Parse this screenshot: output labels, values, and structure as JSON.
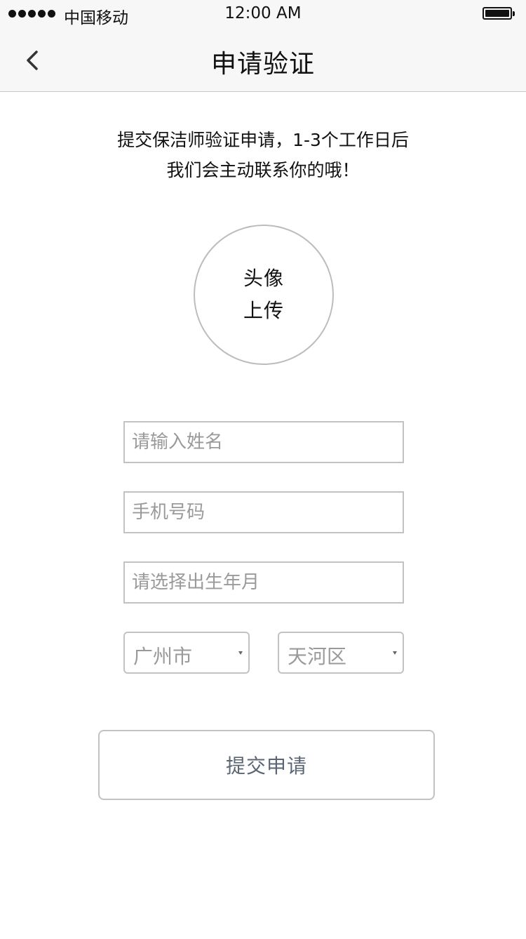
{
  "status_bar": {
    "carrier": "中国移动",
    "time": "12:00 AM"
  },
  "nav": {
    "title": "申请验证",
    "back_icon": "chevron-left-icon"
  },
  "intro": {
    "line1": "提交保洁师验证申请，1-3个工作日后",
    "line2": "我们会主动联系你的哦！"
  },
  "avatar_upload": {
    "line1": "头像",
    "line2": "上传"
  },
  "form": {
    "name_placeholder": "请输入姓名",
    "phone_placeholder": "手机号码",
    "birth_placeholder": "请选择出生年月",
    "city": "广州市",
    "district": "天河区"
  },
  "submit_label": "提交申请"
}
